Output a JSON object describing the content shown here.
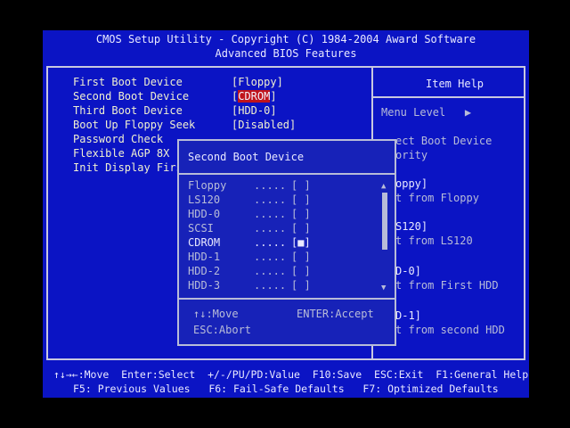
{
  "header": {
    "line1": "CMOS Setup Utility - Copyright (C) 1984-2004 Award Software",
    "line2": "Advanced BIOS Features"
  },
  "settings": [
    {
      "label": "First Boot Device",
      "value": "[Floppy]"
    },
    {
      "label": "Second Boot Device",
      "value": "[CDROM]",
      "selected": true
    },
    {
      "label": "Third Boot Device",
      "value": "[HDD-0]"
    },
    {
      "label": "Boot Up Floppy Seek",
      "value": "[Disabled]"
    },
    {
      "label": "Password Check",
      "value": ""
    },
    {
      "label": "Flexible AGP 8X",
      "value": ""
    },
    {
      "label": "Init Display Firs",
      "value": ""
    }
  ],
  "item_help": {
    "title": "Item Help",
    "menu_level": "Menu Level   ▶",
    "lines": [
      "ect Boot Device",
      "ority",
      "",
      "oppy]",
      "t from Floppy",
      "",
      "S120]",
      "t from LS120",
      "",
      "D-0]",
      "t from First HDD",
      "",
      "D-1]",
      "t from second HDD"
    ]
  },
  "popup": {
    "title": "Second Boot Device",
    "options": [
      {
        "name": "Floppy",
        "dots": ".....",
        "mark": "[ ]"
      },
      {
        "name": "LS120",
        "dots": ".....",
        "mark": "[ ]"
      },
      {
        "name": "HDD-0",
        "dots": ".....",
        "mark": "[ ]"
      },
      {
        "name": "SCSI",
        "dots": ".....",
        "mark": "[ ]"
      },
      {
        "name": "CDROM",
        "dots": ".....",
        "mark": "[■]"
      },
      {
        "name": "HDD-1",
        "dots": ".....",
        "mark": "[ ]"
      },
      {
        "name": "HDD-2",
        "dots": ".....",
        "mark": "[ ]"
      },
      {
        "name": "HDD-3",
        "dots": ".....",
        "mark": "[ ]"
      }
    ],
    "hint_move": "↑↓:Move",
    "hint_accept": "ENTER:Accept",
    "hint_abort": "ESC:Abort"
  },
  "footer": {
    "line1": "↑↓→←:Move  Enter:Select  +/-/PU/PD:Value  F10:Save  ESC:Exit  F1:General Help",
    "line2": "F5: Previous Values   F6: Fail-Safe Defaults   F7: Optimized Defaults"
  },
  "colors": {
    "background": "#0b14c4",
    "selection": "#c0141c",
    "text": "#e8e8ff"
  }
}
